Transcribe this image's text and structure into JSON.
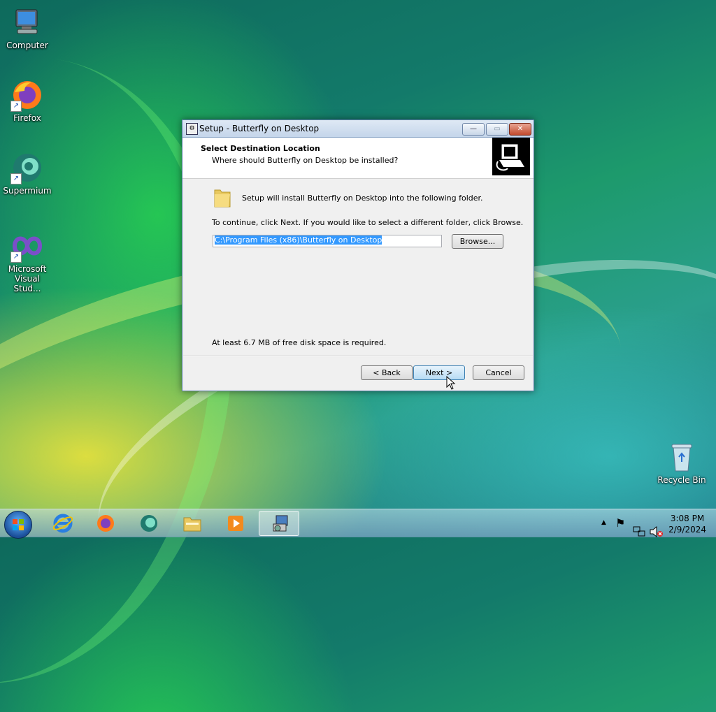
{
  "desktop": {
    "icons": [
      {
        "label_line1": "Computer",
        "label_line2": ""
      },
      {
        "label_line1": "Firefox",
        "label_line2": ""
      },
      {
        "label_line1": "Supermium",
        "label_line2": ""
      },
      {
        "label_line1": "Microsoft",
        "label_line2": "Visual Stud..."
      },
      {
        "label_line1": "Recycle Bin",
        "label_line2": ""
      }
    ]
  },
  "dialog": {
    "title": "Setup - Butterfly on Desktop",
    "header_title": "Select Destination Location",
    "header_subtitle": "Where should Butterfly on Desktop be installed?",
    "install_message": "Setup will install Butterfly on Desktop into the following folder.",
    "continue_message": "To continue, click Next. If you would like to select a different folder, click Browse.",
    "path_value": "C:\\Program Files (x86)\\Butterfly on Desktop",
    "browse_label": "Browse...",
    "disk_space_message": "At least 6.7 MB of free disk space is required.",
    "back_label": "< Back",
    "next_label": "Next >",
    "cancel_label": "Cancel",
    "minimize_glyph": "—",
    "maximize_glyph": "▭",
    "close_glyph": "✕"
  },
  "taskbar": {
    "apps": [
      "internet-explorer-icon",
      "firefox-icon",
      "supermium-icon",
      "file-explorer-icon",
      "media-player-icon",
      "setup-icon"
    ],
    "tray": {
      "show_hidden_glyph": "▲",
      "flag_glyph": "⚑"
    },
    "time": "3:08 PM",
    "date": "2/9/2024"
  },
  "colors": {
    "selection": "#3399ff",
    "default_button": "#3c7fb1"
  }
}
